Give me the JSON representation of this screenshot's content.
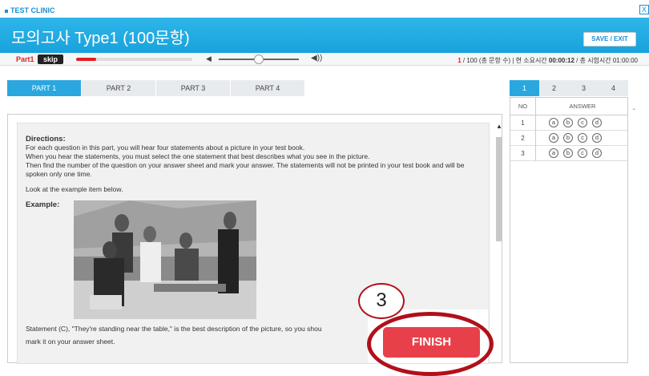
{
  "app": {
    "brand": "TEST CLINIC",
    "close_label": "X"
  },
  "header": {
    "title": "모의고사 Type1 (100문항)",
    "save_exit": "SAVE / EXIT"
  },
  "progress": {
    "part_label": "Part1",
    "skip_label": "skip",
    "audio_progress_fraction": 0.17,
    "volume_fraction": 0.5,
    "current_question": "1",
    "status_rest": " / 100 (총 문항 수)  |  현 소요시간 ",
    "elapsed": "00:00:12",
    "status_mid": " / 총 시험시간 ",
    "total_time": "01:00:00"
  },
  "part_tabs": [
    {
      "label": "PART 1",
      "active": true
    },
    {
      "label": "PART 2",
      "active": false
    },
    {
      "label": "PART 3",
      "active": false
    },
    {
      "label": "PART 4",
      "active": false
    }
  ],
  "content": {
    "directions_title": "Directions:",
    "directions_lines": [
      "For each question in this part, you will hear four statements about a picture in your test book.",
      "When you hear the statements, you must select the one statement that best describes what you see in the picture.",
      "Then find the number of the question on your answer sheet and mark your answer. The statements will not be printed in your test book and will be spoken only one time."
    ],
    "example_intro": "Look at the example item below.",
    "example_label": "Example:",
    "statement_line1": "Statement (C), \"They're standing near the table,\" is the best description of the picture, so you shou",
    "statement_line2": "mark it on your answer sheet."
  },
  "answer_sheet": {
    "tabs": [
      "1",
      "2",
      "3",
      "4"
    ],
    "active_tab": 0,
    "col_no": "NO",
    "col_answer": "ANSWER",
    "options": [
      "a",
      "b",
      "c",
      "d"
    ],
    "rows": [
      "1",
      "2",
      "3"
    ]
  },
  "finish": {
    "label": "FINISH"
  },
  "callout": {
    "number": "3",
    "color": "#b0101a"
  },
  "colors": {
    "accent": "#2aa7df",
    "header": "#1fa8e0",
    "finish": "#e8404a",
    "part_label": "#e02020"
  }
}
